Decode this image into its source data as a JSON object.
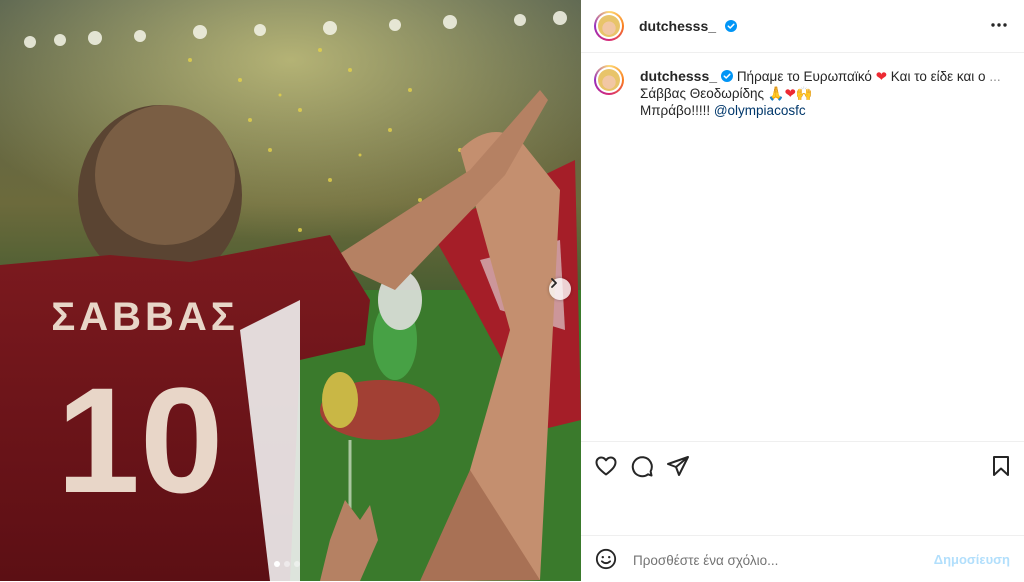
{
  "post": {
    "username": "dutchesss_",
    "caption_line1": "Πήραμε το Ευρωπαϊκό",
    "caption_line1b": "Και το είδε και ο",
    "caption_more": "...",
    "caption_line2": "Σάββας Θεοδωρίδης",
    "caption_line3": "Μπράβο!!!!!",
    "mention": "@olympiacosfc",
    "jersey_name": "ΣΑΒΒΑΣ",
    "jersey_number": "10"
  },
  "comment": {
    "placeholder": "Προσθέστε ένα σχόλιο...",
    "post_label": "Δημοσίευση"
  },
  "carousel": {
    "count": 3,
    "active": 1
  },
  "colors": {
    "accent": "#0095f6",
    "verified": "#0095f6",
    "mention": "#00376b",
    "heart": "#ed2a33"
  },
  "icons": [
    "more-icon",
    "verified-icon",
    "heart-icon",
    "comment-icon",
    "share-icon",
    "save-icon",
    "emoji-icon",
    "chevron-right-icon"
  ]
}
